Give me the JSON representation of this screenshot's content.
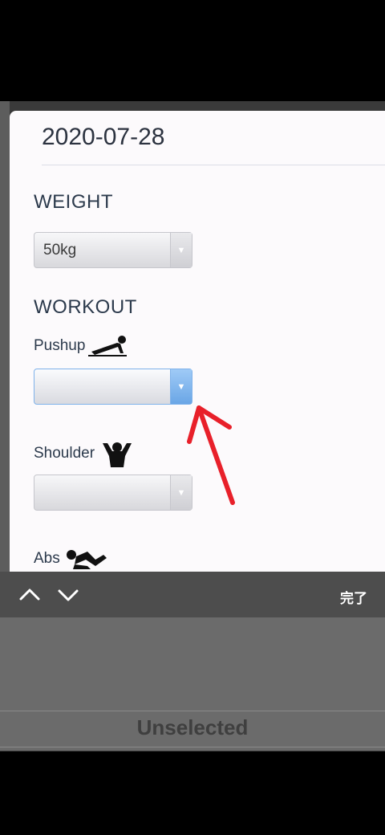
{
  "date": "2020-07-28",
  "weight": {
    "title": "WEIGHT",
    "selected": "50kg"
  },
  "workout": {
    "title": "WORKOUT",
    "items": [
      {
        "label": "Pushup",
        "icon": "pushup-icon",
        "selected": ""
      },
      {
        "label": "Shoulder",
        "icon": "shoulder-icon",
        "selected": ""
      },
      {
        "label": "Abs",
        "icon": "abs-icon"
      }
    ]
  },
  "toolbar": {
    "done_label": "完了"
  },
  "picker": {
    "option": "Unselected"
  },
  "colors": {
    "accent": "#6aa6e6",
    "annotation": "#e8202a"
  }
}
